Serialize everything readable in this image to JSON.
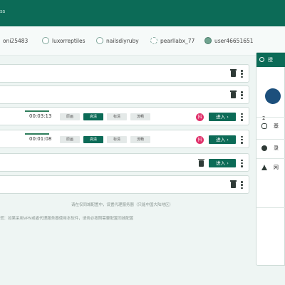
{
  "header": {
    "text_fragment": "ss"
  },
  "users": [
    {
      "name": "oni25483",
      "avatar": "ring"
    },
    {
      "name": "luxorreptiles",
      "avatar": "ring"
    },
    {
      "name": "nailsdiyruby",
      "avatar": "ring"
    },
    {
      "name": "pearllabx_77",
      "avatar": "dashed"
    },
    {
      "name": "user46651651",
      "avatar": "filled"
    }
  ],
  "rows": [
    {
      "type": "simple"
    },
    {
      "type": "simple"
    },
    {
      "type": "stream",
      "timer": "00:03:13",
      "qualities": [
        "原画",
        "高清",
        "标清",
        "流畅"
      ],
      "selected_quality": "高清",
      "badge": "抖",
      "enter_label": "进入 ›"
    },
    {
      "type": "stream",
      "timer": "00:01:08",
      "qualities": [
        "原画",
        "高清",
        "标清",
        "流畅"
      ],
      "selected_quality": "高清",
      "badge": "抖",
      "enter_label": "进入 ›"
    },
    {
      "type": "enter",
      "enter_label": "进入 ›"
    },
    {
      "type": "simple"
    }
  ],
  "notes": {
    "line1": "请在仅同城配置中，设置代理服务器（只能中国大陆地区）",
    "line2": "谎：如果采用VPN或者代理服务器使用本软件，请务必按照需要配置同城配置"
  },
  "sidebar": {
    "header_label": "授",
    "number": "2",
    "items": [
      {
        "icon": "database-icon",
        "label": "基"
      },
      {
        "icon": "record-icon",
        "label": "录"
      },
      {
        "icon": "network-icon",
        "label": "网"
      }
    ]
  },
  "colors": {
    "primary": "#0c6b57",
    "badge": "#e0306a",
    "background": "#eef5f3"
  }
}
